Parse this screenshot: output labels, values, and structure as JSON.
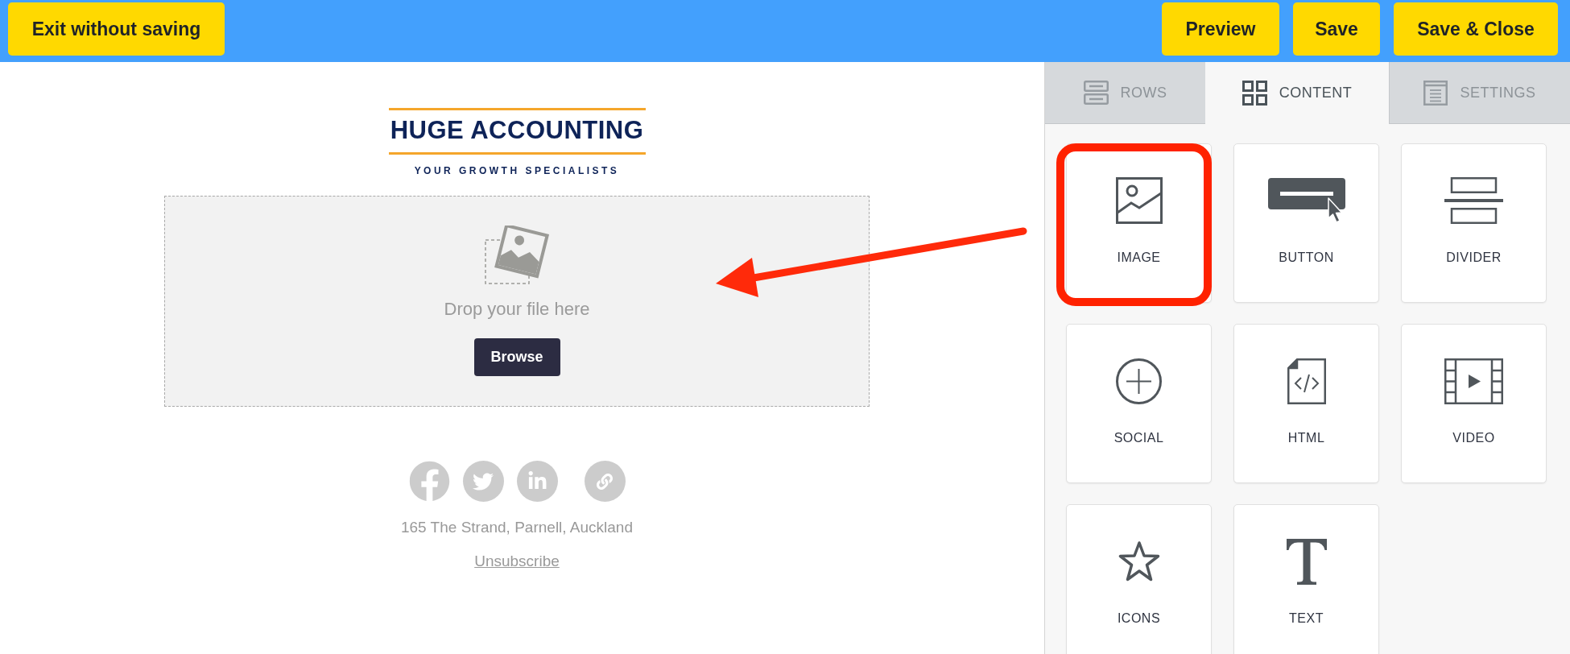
{
  "toolbar": {
    "exit_button": "Exit without saving",
    "actions": [
      "Preview",
      "Save",
      "Save & Close"
    ]
  },
  "email": {
    "logo": {
      "name": "HUGE ACCOUNTING",
      "tagline": "YOUR GROWTH SPECIALISTS"
    },
    "image_dropzone": {
      "prompt": "Drop your file here",
      "button": "Browse"
    },
    "footer": {
      "address": "165 The Strand, Parnell, Auckland",
      "unsubscribe": "Unsubscribe"
    }
  },
  "panel": {
    "tabs": [
      {
        "label": "ROWS",
        "kind": "rows",
        "selected": false
      },
      {
        "label": "CONTENT",
        "kind": "content",
        "selected": true
      },
      {
        "label": "SETTINGS",
        "kind": "settings",
        "selected": false
      }
    ],
    "blocks": [
      {
        "label": "IMAGE",
        "kind": "image",
        "highlighted": true
      },
      {
        "label": "BUTTON",
        "kind": "button",
        "highlighted": false
      },
      {
        "label": "DIVIDER",
        "kind": "divider",
        "highlighted": false
      },
      {
        "label": "SOCIAL",
        "kind": "social",
        "highlighted": false
      },
      {
        "label": "HTML",
        "kind": "html",
        "highlighted": false
      },
      {
        "label": "VIDEO",
        "kind": "video",
        "highlighted": false
      },
      {
        "label": "ICONS",
        "kind": "icons",
        "highlighted": false
      },
      {
        "label": "TEXT",
        "kind": "text",
        "highlighted": false
      }
    ]
  }
}
